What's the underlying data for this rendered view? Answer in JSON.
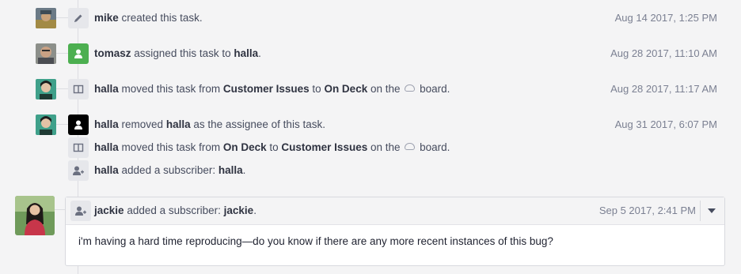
{
  "events": [
    {
      "user": "mike",
      "pre": "created this task.",
      "time": "Aug 14 2017, 1:25 PM",
      "icon": "pencil-icon"
    },
    {
      "user": "tomasz",
      "pre": "assigned this task to",
      "target": "halla",
      "post": ".",
      "time": "Aug 28 2017, 11:10 AM",
      "icon": "user-icon"
    },
    {
      "user": "halla",
      "pre": "moved this task from",
      "from": "Customer Issues",
      "mid": "to",
      "to": "On Deck",
      "post1": "on the",
      "post2": "board.",
      "time": "Aug 28 2017, 11:17 AM",
      "icon": "board-icon"
    },
    {
      "user": "halla",
      "pre": "removed",
      "target": "halla",
      "post": "as the assignee of this task.",
      "time": "Aug 31 2017, 6:07 PM",
      "icon": "user-icon"
    },
    {
      "user": "halla",
      "pre": "moved this task from",
      "from": "On Deck",
      "mid": "to",
      "to": "Customer Issues",
      "post1": "on the",
      "post2": "board.",
      "icon": "board-icon"
    },
    {
      "user": "halla",
      "pre": "added a subscriber:",
      "target": "halla",
      "post": ".",
      "icon": "add-subscriber-icon"
    }
  ],
  "comment": {
    "user": "jackie",
    "pre": "added a subscriber:",
    "target": "jackie",
    "post": ".",
    "time": "Sep 5 2017, 2:41 PM",
    "body": "i'm having a hard time reproducing—do you know if there are any more recent instances of this bug?",
    "icon": "add-subscriber-icon"
  },
  "colors": {
    "green_badge": "#4caf50",
    "black_badge": "#000000",
    "background": "#f4f4f5"
  }
}
